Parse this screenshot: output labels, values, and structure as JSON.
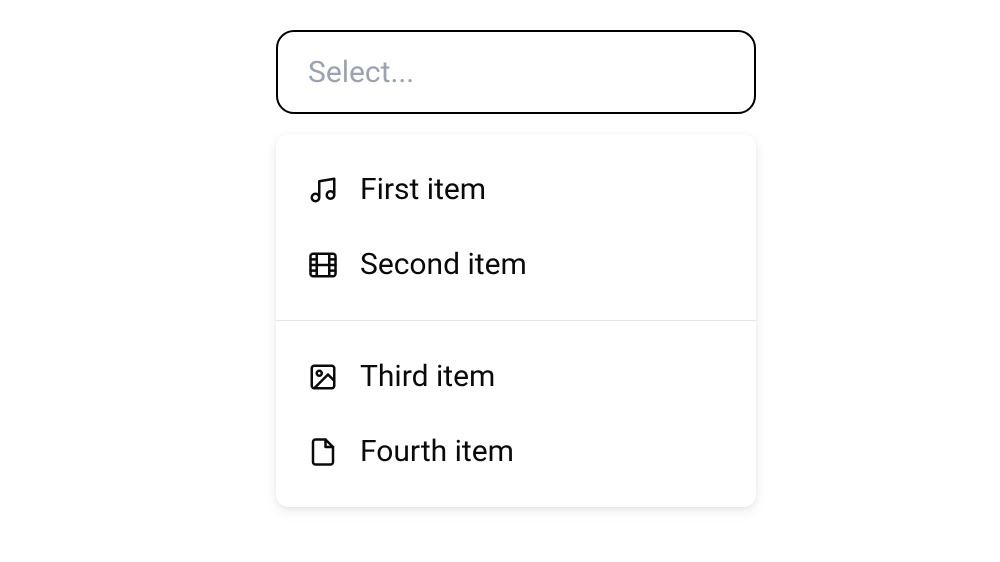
{
  "select": {
    "placeholder": "Select..."
  },
  "dropdown": {
    "groups": [
      {
        "items": [
          {
            "icon": "music",
            "label": "First item"
          },
          {
            "icon": "film",
            "label": "Second item"
          }
        ]
      },
      {
        "items": [
          {
            "icon": "image",
            "label": "Third item"
          },
          {
            "icon": "file",
            "label": "Fourth item"
          }
        ]
      }
    ]
  }
}
